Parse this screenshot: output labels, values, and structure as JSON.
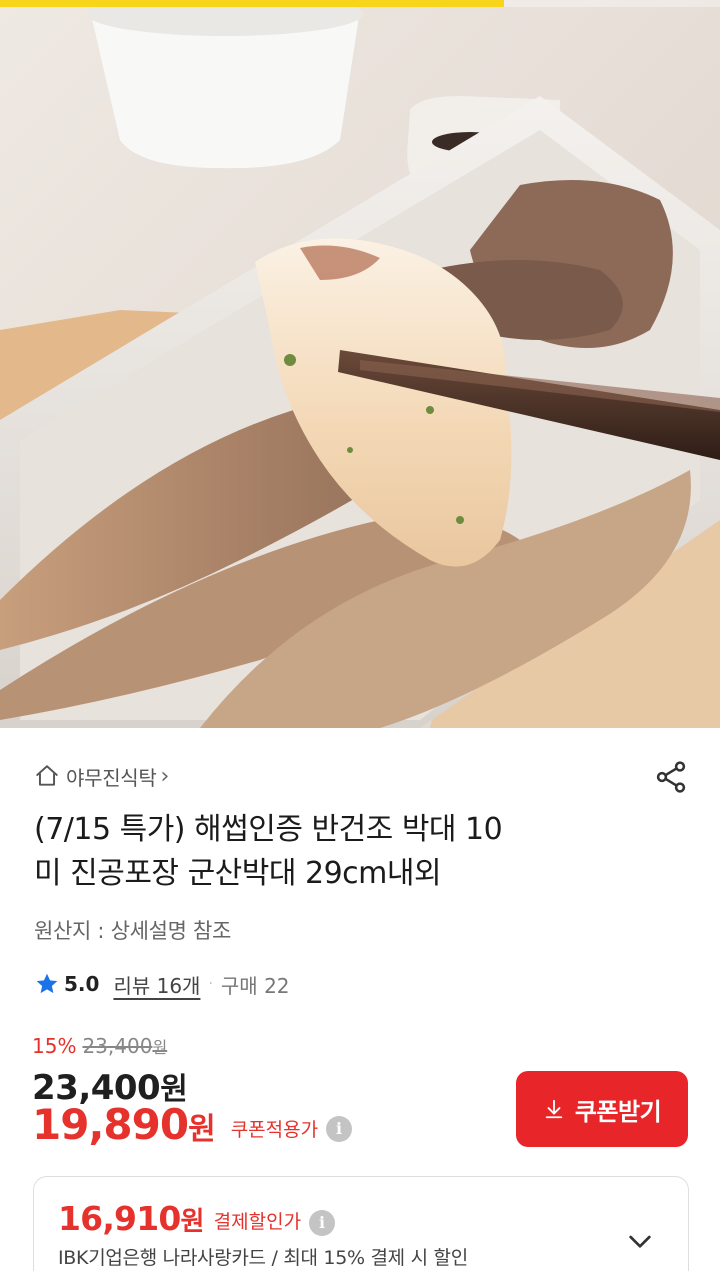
{
  "gallery": {
    "progress": 0.7,
    "image_alt": "반건조 박대 구이 사진"
  },
  "store": {
    "name": "야무진식탁",
    "chevron": "›"
  },
  "product": {
    "title_line1": "(7/15 특가) 해썹인증 반건조 박대 10",
    "title_line2": "미 진공포장 군산박대 29cm내외",
    "origin": "원산지 : 상세설명 참조"
  },
  "rating": {
    "score": "5.0",
    "review_label": "리뷰 16개",
    "dot": "·",
    "purchase_label": "구매 22"
  },
  "price": {
    "discount_rate": "15%",
    "original_price": "23,400",
    "original_won": "원",
    "sale_price": "23,400",
    "sale_won": "원",
    "coupon_price": "19,890",
    "coupon_won": "원",
    "coupon_note": "쿠폰적용가",
    "info_glyph": "i"
  },
  "coupon_button": {
    "label": "쿠폰받기"
  },
  "card_discount": {
    "price": "16,910",
    "won": "원",
    "note": "결제할인가",
    "description": "IBK기업은행 나라사랑카드 / 최대 15% 결제 시 할인"
  },
  "colors": {
    "accent_red": "#e5322d",
    "button_red": "#e8262a",
    "progress_yellow": "#f7d51a",
    "star_blue": "#1a73e8"
  },
  "icons": {
    "store": "home-icon",
    "share": "share-icon",
    "star": "star-icon",
    "info": "info-icon",
    "download": "download-icon",
    "expand": "chevron-down-icon"
  }
}
